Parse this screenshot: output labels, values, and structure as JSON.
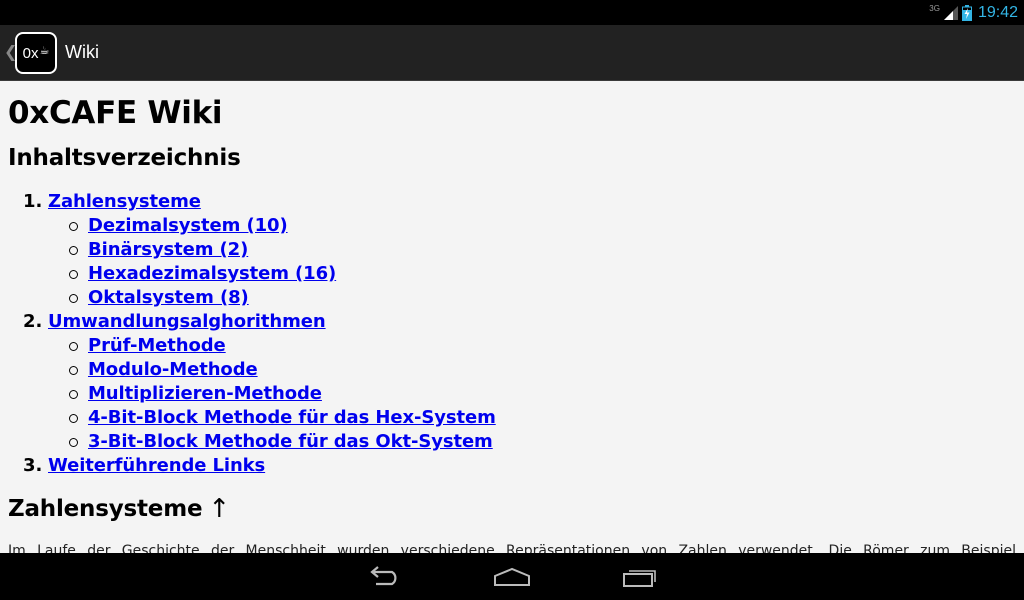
{
  "status_bar": {
    "network_type": "3G",
    "time": "19:42",
    "accent_color": "#33b5e5"
  },
  "action_bar": {
    "app_icon_text": "0x",
    "title": "Wiki"
  },
  "page": {
    "title": "0xCAFE Wiki",
    "toc_heading": "Inhaltsverzeichnis",
    "link_color": "#0000ee",
    "toc": [
      {
        "number": "1.",
        "label": "Zahlensysteme",
        "children": [
          "Dezimalsystem (10)",
          "Binärsystem (2)",
          "Hexadezimalsystem (16)",
          "Oktalsystem (8)"
        ]
      },
      {
        "number": "2.",
        "label": "Umwandlungsalghorithmen",
        "children": [
          "Prüf-Methode",
          "Modulo-Methode",
          "Multiplizieren-Methode",
          "4-Bit-Block Methode für das Hex-System",
          "3-Bit-Block Methode für das Okt-System"
        ]
      },
      {
        "number": "3.",
        "label": "Weiterführende Links",
        "children": []
      }
    ],
    "section_heading": "Zahlensysteme",
    "section_arrow": "↑",
    "paragraph_visible": "Im Laufe der Geschichte der Menschheit wurden verschiedene Repräsentationen von Zahlen verwendet. Die Römer zum Beispiel"
  },
  "nav_bar": {
    "buttons": [
      "back",
      "home",
      "recent-apps"
    ]
  }
}
